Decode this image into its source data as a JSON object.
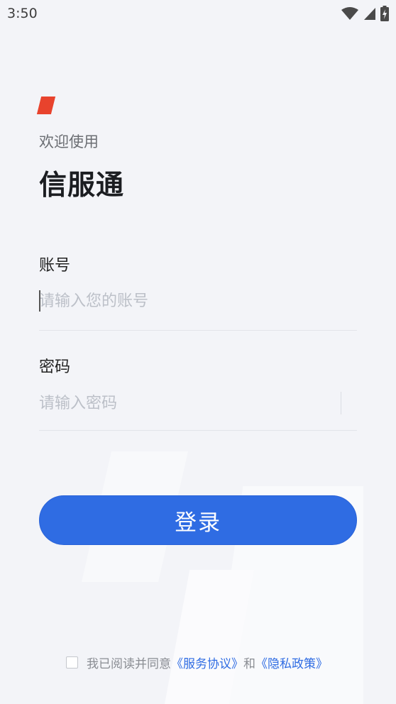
{
  "status_bar": {
    "time": "3:50",
    "icons": [
      "wifi-icon",
      "cell-signal-icon",
      "battery-charging-icon"
    ]
  },
  "header": {
    "welcome": "欢迎使用",
    "title": "信服通",
    "brand_color": "#e8432d"
  },
  "form": {
    "account": {
      "label": "账号",
      "placeholder": "请输入您的账号",
      "value": ""
    },
    "password": {
      "label": "密码",
      "placeholder": "请输入密码",
      "value": ""
    }
  },
  "login_button": {
    "label": "登录",
    "color": "#2f6ce3"
  },
  "agreement": {
    "checked": false,
    "prefix": "我已阅读并同意",
    "service_link": "《服务协议》",
    "conjunction": "和",
    "privacy_link": "《隐私政策》",
    "link_color": "#2f6ce3"
  }
}
